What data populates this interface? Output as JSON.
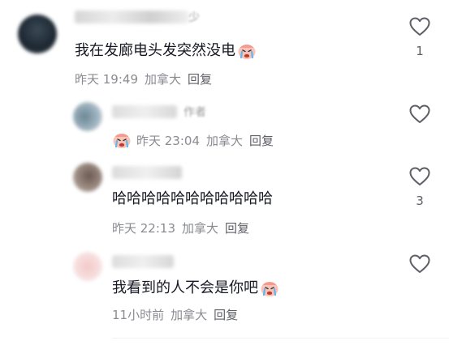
{
  "comments": [
    {
      "text": "我在发廊电头发突然没电",
      "time": "昨天 19:49",
      "location": "加拿大",
      "reply_label": "回复",
      "likes": "1",
      "name_suffix": "少",
      "emoji": "crying-face-icon"
    },
    {
      "text": "",
      "time": "昨天 23:04",
      "location": "加拿大",
      "reply_label": "回复",
      "likes": "",
      "name_suffix": "作者",
      "emoji": "crying-face-icon"
    },
    {
      "text": "哈哈哈哈哈哈哈哈哈哈哈",
      "time": "昨天 22:13",
      "location": "加拿大",
      "reply_label": "回复",
      "likes": "3",
      "name_suffix": "",
      "emoji": ""
    },
    {
      "text": "我看到的人不会是你吧",
      "time": "11小时前",
      "location": "加拿大",
      "reply_label": "回复",
      "likes": "",
      "name_suffix": "",
      "emoji": "crying-face-icon"
    }
  ],
  "colors": {
    "text": "#161823",
    "meta": "#8a8b91",
    "heart_stroke": "#5e5f66",
    "emoji_face": "#f7b0a8"
  }
}
